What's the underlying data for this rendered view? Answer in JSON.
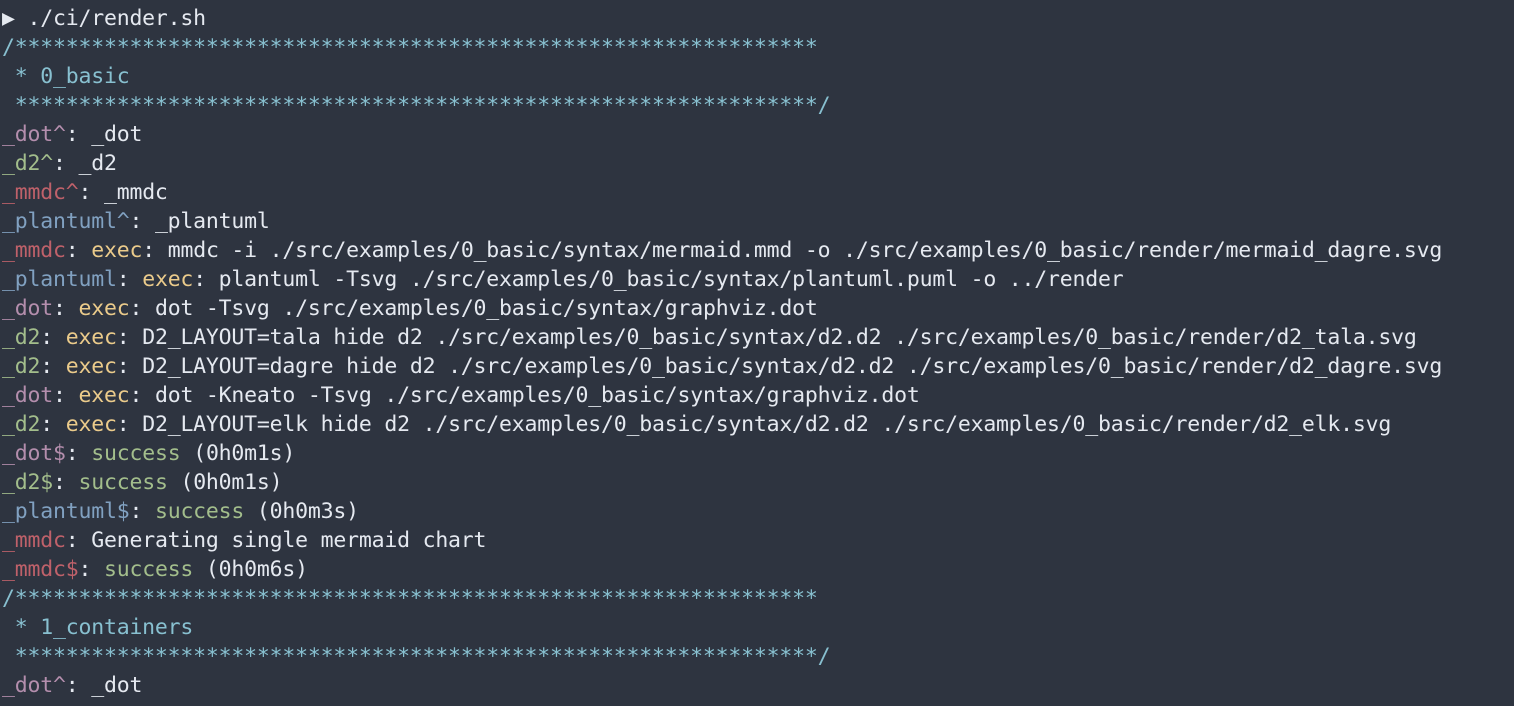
{
  "colors": {
    "background": "#2e3440",
    "default": "#e5e9f0",
    "cyan": "#88c0d0",
    "blue": "#81a1c1",
    "purple": "#b48ead",
    "green": "#a3be8c",
    "red": "#bf616a",
    "yellow": "#ebcb8b"
  },
  "terminal": {
    "lines": [
      {
        "segments": [
          {
            "t": "▶ ./ci/render.sh",
            "c": "default"
          }
        ]
      },
      {
        "segments": [
          {
            "t": "/***************************************************************",
            "c": "cyan"
          }
        ]
      },
      {
        "segments": [
          {
            "t": " * 0_basic",
            "c": "cyan"
          }
        ]
      },
      {
        "segments": [
          {
            "t": " ***************************************************************/",
            "c": "cyan"
          }
        ]
      },
      {
        "segments": [
          {
            "t": "_dot^",
            "c": "purple"
          },
          {
            "t": ": _dot",
            "c": "default"
          }
        ]
      },
      {
        "segments": [
          {
            "t": "_d2^",
            "c": "green"
          },
          {
            "t": ": _d2",
            "c": "default"
          }
        ]
      },
      {
        "segments": [
          {
            "t": "_mmdc^",
            "c": "red"
          },
          {
            "t": ": _mmdc",
            "c": "default"
          }
        ]
      },
      {
        "segments": [
          {
            "t": "_plantuml^",
            "c": "blue"
          },
          {
            "t": ": _plantuml",
            "c": "default"
          }
        ]
      },
      {
        "segments": [
          {
            "t": "_mmdc",
            "c": "red"
          },
          {
            "t": ": ",
            "c": "default"
          },
          {
            "t": "exec",
            "c": "yellow"
          },
          {
            "t": ": mmdc -i ./src/examples/0_basic/syntax/mermaid.mmd -o ./src/examples/0_basic/render/mermaid_dagre.svg",
            "c": "default"
          }
        ]
      },
      {
        "segments": [
          {
            "t": "_plantuml",
            "c": "blue"
          },
          {
            "t": ": ",
            "c": "default"
          },
          {
            "t": "exec",
            "c": "yellow"
          },
          {
            "t": ": plantuml -Tsvg ./src/examples/0_basic/syntax/plantuml.puml -o ../render",
            "c": "default"
          }
        ]
      },
      {
        "segments": [
          {
            "t": "_dot",
            "c": "purple"
          },
          {
            "t": ": ",
            "c": "default"
          },
          {
            "t": "exec",
            "c": "yellow"
          },
          {
            "t": ": dot -Tsvg ./src/examples/0_basic/syntax/graphviz.dot",
            "c": "default"
          }
        ]
      },
      {
        "segments": [
          {
            "t": "_d2",
            "c": "green"
          },
          {
            "t": ": ",
            "c": "default"
          },
          {
            "t": "exec",
            "c": "yellow"
          },
          {
            "t": ": D2_LAYOUT=tala hide d2 ./src/examples/0_basic/syntax/d2.d2 ./src/examples/0_basic/render/d2_tala.svg",
            "c": "default"
          }
        ]
      },
      {
        "segments": [
          {
            "t": "_d2",
            "c": "green"
          },
          {
            "t": ": ",
            "c": "default"
          },
          {
            "t": "exec",
            "c": "yellow"
          },
          {
            "t": ": D2_LAYOUT=dagre hide d2 ./src/examples/0_basic/syntax/d2.d2 ./src/examples/0_basic/render/d2_dagre.svg",
            "c": "default"
          }
        ]
      },
      {
        "segments": [
          {
            "t": "_dot",
            "c": "purple"
          },
          {
            "t": ": ",
            "c": "default"
          },
          {
            "t": "exec",
            "c": "yellow"
          },
          {
            "t": ": dot -Kneato -Tsvg ./src/examples/0_basic/syntax/graphviz.dot",
            "c": "default"
          }
        ]
      },
      {
        "segments": [
          {
            "t": "_d2",
            "c": "green"
          },
          {
            "t": ": ",
            "c": "default"
          },
          {
            "t": "exec",
            "c": "yellow"
          },
          {
            "t": ": D2_LAYOUT=elk hide d2 ./src/examples/0_basic/syntax/d2.d2 ./src/examples/0_basic/render/d2_elk.svg",
            "c": "default"
          }
        ]
      },
      {
        "segments": [
          {
            "t": "_dot$",
            "c": "purple"
          },
          {
            "t": ": ",
            "c": "default"
          },
          {
            "t": "success",
            "c": "green"
          },
          {
            "t": " (0h0m1s)",
            "c": "default"
          }
        ]
      },
      {
        "segments": [
          {
            "t": "_d2$",
            "c": "green"
          },
          {
            "t": ": ",
            "c": "default"
          },
          {
            "t": "success",
            "c": "green"
          },
          {
            "t": " (0h0m1s)",
            "c": "default"
          }
        ]
      },
      {
        "segments": [
          {
            "t": "_plantuml$",
            "c": "blue"
          },
          {
            "t": ": ",
            "c": "default"
          },
          {
            "t": "success",
            "c": "green"
          },
          {
            "t": " (0h0m3s)",
            "c": "default"
          }
        ]
      },
      {
        "segments": [
          {
            "t": "_mmdc",
            "c": "red"
          },
          {
            "t": ": Generating single mermaid chart",
            "c": "default"
          }
        ]
      },
      {
        "segments": [
          {
            "t": "_mmdc$",
            "c": "red"
          },
          {
            "t": ": ",
            "c": "default"
          },
          {
            "t": "success",
            "c": "green"
          },
          {
            "t": " (0h0m6s)",
            "c": "default"
          }
        ]
      },
      {
        "segments": [
          {
            "t": "/***************************************************************",
            "c": "cyan"
          }
        ]
      },
      {
        "segments": [
          {
            "t": " * 1_containers",
            "c": "cyan"
          }
        ]
      },
      {
        "segments": [
          {
            "t": " ***************************************************************/",
            "c": "cyan"
          }
        ]
      },
      {
        "segments": [
          {
            "t": "_dot^",
            "c": "purple"
          },
          {
            "t": ": _dot",
            "c": "default"
          }
        ]
      }
    ]
  }
}
